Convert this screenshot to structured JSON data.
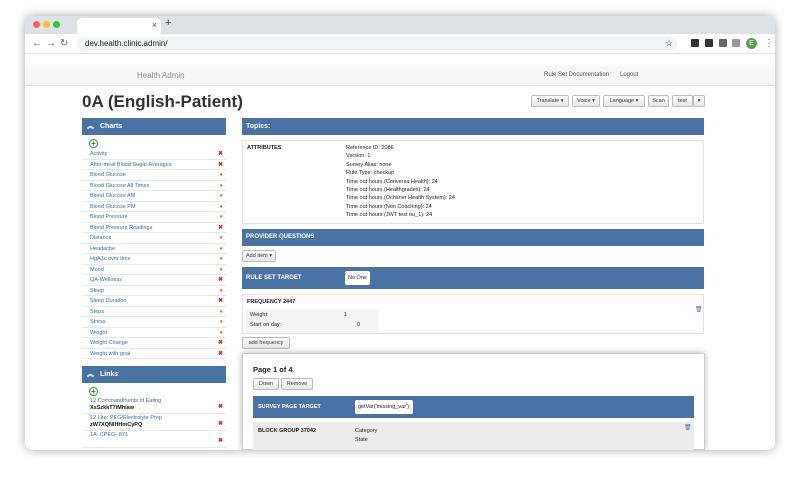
{
  "browser": {
    "tab_close": "×",
    "new_tab": "+",
    "url": "dev.health.clinic.admin/",
    "profile_initial": "E",
    "back_icon": "←",
    "forward_icon": "→",
    "reload_icon": "↻",
    "star_icon": "☆",
    "menu_icon": "⋮"
  },
  "header": {
    "brand": "Health Admin",
    "links": [
      "Rule Set Documentation",
      "Logout"
    ]
  },
  "page": {
    "title": "0A (English-Patient)",
    "buttons": [
      "Translate ▾",
      "Voice ▾",
      "Language ▾",
      "Scan",
      "test",
      "▾"
    ]
  },
  "charts": {
    "title": "Charts",
    "chevron": "︽",
    "add": "+",
    "items": [
      {
        "label": "Activity",
        "status": "✖"
      },
      {
        "label": "After-meal Blood Sugar Averages",
        "status": "✖"
      },
      {
        "label": "Blood Glucose",
        "status": "●"
      },
      {
        "label": "Blood Glucose All Times",
        "status": "●"
      },
      {
        "label": "Blood Glucose AM",
        "status": "●"
      },
      {
        "label": "Blood Glucose PM",
        "status": "●"
      },
      {
        "label": "Blood Pressure",
        "status": "●"
      },
      {
        "label": "Blood Pressure Readings",
        "status": "✖"
      },
      {
        "label": "Distance",
        "status": "●"
      },
      {
        "label": "Headache",
        "status": "●"
      },
      {
        "label": "HgA1c over time",
        "status": "●"
      },
      {
        "label": "Mood",
        "status": "●"
      },
      {
        "label": "QA-Wellness",
        "status": "✖"
      },
      {
        "label": "Sleep",
        "status": "●"
      },
      {
        "label": "Sleep Duration",
        "status": "✖"
      },
      {
        "label": "Steps",
        "status": "●"
      },
      {
        "label": "Stress",
        "status": "●"
      },
      {
        "label": "Weight",
        "status": "●"
      },
      {
        "label": "Weight Change",
        "status": "✖"
      },
      {
        "label": "Weight with goal",
        "status": "✖"
      }
    ]
  },
  "links": {
    "title": "Links",
    "chevron": "︽",
    "add": "+",
    "items": [
      {
        "title": "12 Commandments of Eating",
        "code": "XsSzkkT7iMhiaw",
        "status": "✖"
      },
      {
        "title": "12 Liter PEG/Electrolyte Prep",
        "code": "zW7XQNlHHmCyPQ",
        "status": "✖"
      },
      {
        "title": "1A: CPEG- 871",
        "code": "",
        "status": "✖"
      }
    ]
  },
  "topics": {
    "title": "Topics:",
    "attributes_label": "ATTRIBUTES",
    "attributes": [
      "Reference ID: 2086",
      "Version: 1",
      "Survey Alias: none",
      "Rule Type: checkup",
      "Time out hours (Conversa Health): 24",
      "Time out hours (Healthgrades): 24",
      "Time out hours (Ochsner Health System): 24",
      "Time out hours (Non Coaching): 24",
      "Time out hours (JWT test ou_1): 24"
    ]
  },
  "provider_questions": {
    "title": "PROVIDER QUESTIONS",
    "add_item": "Add item ▾"
  },
  "rule_set_target": {
    "label": "RULE SET TARGET",
    "value": "No One"
  },
  "frequency": {
    "title": "FREQUENCY 2447",
    "rows": [
      {
        "label": "Weight:",
        "value": "1"
      },
      {
        "label": "Start on day:",
        "value": "0"
      }
    ],
    "add_button": "add frequency",
    "delete_icon": "🗑"
  },
  "survey": {
    "page_label": "Page 1 of 4",
    "down_button": "Down",
    "remove_button": "Remove",
    "target_label": "SURVEY PAGE TARGET",
    "target_value": "getVar('missing_var');",
    "block_group": "BLOCK GROUP 37042",
    "block_fields": [
      "Category",
      "State"
    ],
    "delete_icon": "🗑"
  },
  "colors": {
    "panel_header": "#4a73a3",
    "link": "#3a6ea5",
    "remove_mark": "#c0392b",
    "active_mark": "#e67e22",
    "add_icon": "#2e8b2e"
  }
}
